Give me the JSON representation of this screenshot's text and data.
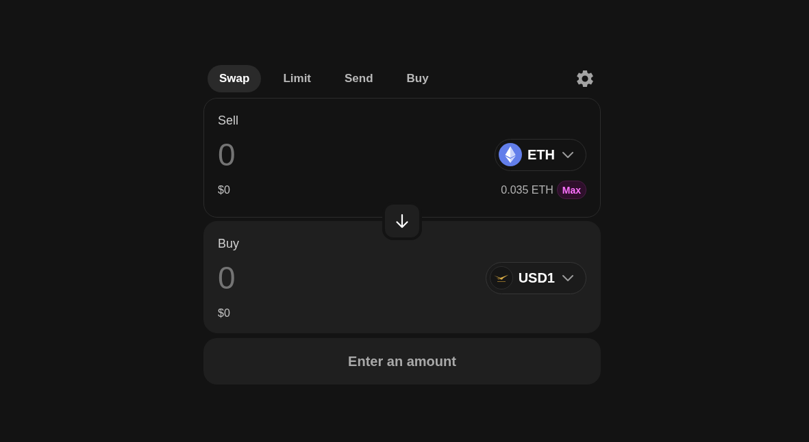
{
  "tabs": [
    {
      "label": "Swap",
      "selected": true
    },
    {
      "label": "Limit",
      "selected": false
    },
    {
      "label": "Send",
      "selected": false
    },
    {
      "label": "Buy",
      "selected": false
    }
  ],
  "sell": {
    "label": "Sell",
    "amount": {
      "placeholder": "0"
    },
    "fiat": "$0",
    "token": {
      "symbol": "ETH",
      "kind": "eth"
    },
    "balance": "0.035 ETH",
    "max_button": "Max"
  },
  "buy": {
    "label": "Buy",
    "amount": {
      "placeholder": "0"
    },
    "fiat": "$0",
    "token": {
      "symbol": "USD1",
      "kind": "usd1"
    }
  },
  "submit_button": {
    "label": "Enter an amount",
    "disabled": true
  }
}
